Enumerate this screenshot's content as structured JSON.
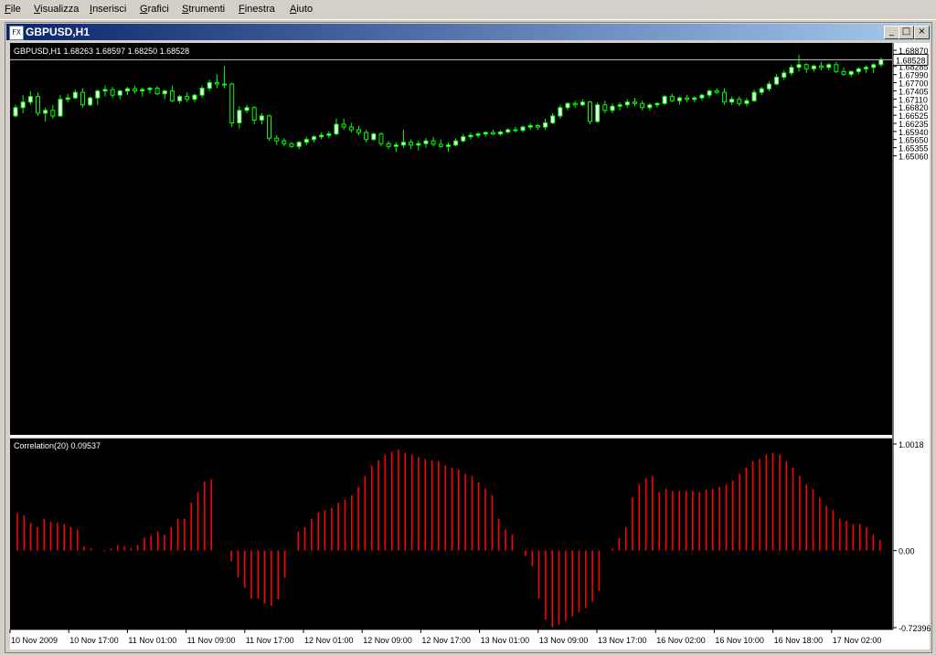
{
  "menu": [
    {
      "label": "File",
      "ul": "F",
      "rest": "ile"
    },
    {
      "label": "Visualizza",
      "ul": "V",
      "rest": "isualizza"
    },
    {
      "label": "Inserisci",
      "ul": "I",
      "rest": "nserisci"
    },
    {
      "label": "Grafici",
      "ul": "G",
      "rest": "rafici"
    },
    {
      "label": "Strumenti",
      "ul": "S",
      "rest": "trumenti"
    },
    {
      "label": "Finestra",
      "ul": "F",
      "rest": "inestra"
    },
    {
      "label": "Aiuto",
      "ul": "A",
      "rest": "iuto"
    }
  ],
  "window": {
    "title": "GBPUSD,H1",
    "icon_text": "FX",
    "minimize": "_",
    "restore": "□",
    "close": "×"
  },
  "price_panel": {
    "info": "GBPUSD,H1  1.68263 1.68597 1.68250 1.68528",
    "current_price": 1.68528,
    "current_price_label": "1.68528",
    "y_min": 1.5506,
    "y_max": 1.6887,
    "y_ticks": [
      "1.68870",
      "1.68285",
      "1.67990",
      "1.67700",
      "1.67405",
      "1.67110",
      "1.66820",
      "1.66525",
      "1.66235",
      "1.65940",
      "1.65650",
      "1.65355",
      "1.65060"
    ]
  },
  "indicator_panel": {
    "label": "Correlation(20) 0.09537",
    "y_min": -0.72396,
    "y_max": 1.0018,
    "y_ticks": [
      "1.0018",
      "0.00",
      "-0.72396"
    ]
  },
  "time_axis": [
    "10 Nov 2009",
    "10 Nov 17:00",
    "11 Nov 01:00",
    "11 Nov 09:00",
    "11 Nov 17:00",
    "12 Nov 01:00",
    "12 Nov 09:00",
    "12 Nov 17:00",
    "13 Nov 01:00",
    "13 Nov 09:00",
    "13 Nov 17:00",
    "16 Nov 02:00",
    "16 Nov 10:00",
    "16 Nov 18:00",
    "17 Nov 02:00"
  ],
  "colors": {
    "chart_bg": "#000000",
    "bull_body": "#ffffff",
    "bear_body": "#000000",
    "candle_line": "#00ff00",
    "histogram": "#ff0000",
    "bid_line": "#c0c0c0",
    "axis_text": "#000000",
    "panel_label": "#ffffff"
  },
  "chart_data": {
    "type": "candlestick",
    "candles": [
      [
        1.665,
        1.669,
        1.6645,
        1.668
      ],
      [
        1.668,
        1.6725,
        1.666,
        1.67
      ],
      [
        1.67,
        1.674,
        1.669,
        1.672
      ],
      [
        1.672,
        1.6735,
        1.665,
        1.666
      ],
      [
        1.666,
        1.668,
        1.663,
        1.667
      ],
      [
        1.667,
        1.669,
        1.664,
        1.665
      ],
      [
        1.665,
        1.6725,
        1.6645,
        1.671
      ],
      [
        1.671,
        1.673,
        1.67,
        1.6715
      ],
      [
        1.6715,
        1.6745,
        1.671,
        1.6735
      ],
      [
        1.6735,
        1.675,
        1.668,
        1.669
      ],
      [
        1.669,
        1.672,
        1.6685,
        1.6715
      ],
      [
        1.6715,
        1.6745,
        1.669,
        1.674
      ],
      [
        1.674,
        1.676,
        1.672,
        1.6745
      ],
      [
        1.6745,
        1.6755,
        1.6715,
        1.6725
      ],
      [
        1.6725,
        1.6745,
        1.671,
        1.674
      ],
      [
        1.674,
        1.6755,
        1.6725,
        1.6748
      ],
      [
        1.6748,
        1.676,
        1.673,
        1.674
      ],
      [
        1.674,
        1.6752,
        1.672,
        1.6745
      ],
      [
        1.6745,
        1.6755,
        1.673,
        1.675
      ],
      [
        1.675,
        1.6758,
        1.6725,
        1.673
      ],
      [
        1.673,
        1.6745,
        1.671,
        1.674
      ],
      [
        1.674,
        1.676,
        1.67,
        1.6705
      ],
      [
        1.6705,
        1.6725,
        1.6695,
        1.672
      ],
      [
        1.672,
        1.6735,
        1.67,
        1.671
      ],
      [
        1.671,
        1.673,
        1.67,
        1.6725
      ],
      [
        1.6725,
        1.676,
        1.6715,
        1.675
      ],
      [
        1.675,
        1.678,
        1.674,
        1.677
      ],
      [
        1.677,
        1.68,
        1.675,
        1.6765
      ],
      [
        1.6765,
        1.683,
        1.675,
        1.6765
      ],
      [
        1.6765,
        1.677,
        1.661,
        1.6625
      ],
      [
        1.6625,
        1.6685,
        1.6605,
        1.667
      ],
      [
        1.667,
        1.669,
        1.666,
        1.668
      ],
      [
        1.668,
        1.6685,
        1.662,
        1.6635
      ],
      [
        1.6635,
        1.666,
        1.662,
        1.665
      ],
      [
        1.665,
        1.6655,
        1.656,
        1.657
      ],
      [
        1.657,
        1.658,
        1.6545,
        1.656
      ],
      [
        1.656,
        1.657,
        1.654,
        1.655
      ],
      [
        1.655,
        1.6555,
        1.6535,
        1.654
      ],
      [
        1.654,
        1.656,
        1.653,
        1.6555
      ],
      [
        1.6555,
        1.6575,
        1.6545,
        1.6565
      ],
      [
        1.6565,
        1.658,
        1.6555,
        1.6575
      ],
      [
        1.6575,
        1.659,
        1.6565,
        1.658
      ],
      [
        1.658,
        1.6595,
        1.657,
        1.6585
      ],
      [
        1.6585,
        1.664,
        1.658,
        1.662
      ],
      [
        1.662,
        1.664,
        1.66,
        1.661
      ],
      [
        1.661,
        1.6625,
        1.659,
        1.66
      ],
      [
        1.66,
        1.6615,
        1.658,
        1.659
      ],
      [
        1.659,
        1.66,
        1.6555,
        1.6565
      ],
      [
        1.6565,
        1.659,
        1.656,
        1.6585
      ],
      [
        1.6585,
        1.659,
        1.654,
        1.655
      ],
      [
        1.655,
        1.656,
        1.653,
        1.654
      ],
      [
        1.654,
        1.6555,
        1.652,
        1.6545
      ],
      [
        1.6545,
        1.66,
        1.6535,
        1.6555
      ],
      [
        1.6555,
        1.6565,
        1.653,
        1.6545
      ],
      [
        1.6545,
        1.656,
        1.6525,
        1.655
      ],
      [
        1.655,
        1.657,
        1.6535,
        1.656
      ],
      [
        1.656,
        1.6575,
        1.654,
        1.6548
      ],
      [
        1.6548,
        1.6565,
        1.6535,
        1.654
      ],
      [
        1.654,
        1.6555,
        1.652,
        1.6545
      ],
      [
        1.6545,
        1.657,
        1.654,
        1.656
      ],
      [
        1.656,
        1.6585,
        1.6555,
        1.6575
      ],
      [
        1.6575,
        1.659,
        1.6565,
        1.658
      ],
      [
        1.658,
        1.6592,
        1.657,
        1.6585
      ],
      [
        1.6585,
        1.6595,
        1.6575,
        1.659
      ],
      [
        1.659,
        1.66,
        1.658,
        1.6585
      ],
      [
        1.6585,
        1.6598,
        1.6578,
        1.6592
      ],
      [
        1.6592,
        1.6605,
        1.6585,
        1.66
      ],
      [
        1.66,
        1.661,
        1.659,
        1.6598
      ],
      [
        1.6598,
        1.6615,
        1.659,
        1.661
      ],
      [
        1.661,
        1.6625,
        1.66,
        1.6615
      ],
      [
        1.6615,
        1.662,
        1.66,
        1.661
      ],
      [
        1.661,
        1.664,
        1.66,
        1.6625
      ],
      [
        1.6625,
        1.666,
        1.662,
        1.665
      ],
      [
        1.665,
        1.669,
        1.664,
        1.668
      ],
      [
        1.668,
        1.67,
        1.667,
        1.6695
      ],
      [
        1.6695,
        1.6705,
        1.668,
        1.669
      ],
      [
        1.669,
        1.671,
        1.6685,
        1.67
      ],
      [
        1.67,
        1.6705,
        1.662,
        1.663
      ],
      [
        1.663,
        1.67,
        1.6625,
        1.669
      ],
      [
        1.669,
        1.6705,
        1.666,
        1.667
      ],
      [
        1.667,
        1.6695,
        1.666,
        1.6685
      ],
      [
        1.6685,
        1.67,
        1.667,
        1.669
      ],
      [
        1.669,
        1.671,
        1.668,
        1.67
      ],
      [
        1.67,
        1.6715,
        1.6685,
        1.6695
      ],
      [
        1.6695,
        1.6705,
        1.667,
        1.668
      ],
      [
        1.668,
        1.6695,
        1.667,
        1.669
      ],
      [
        1.669,
        1.67,
        1.668,
        1.6695
      ],
      [
        1.6695,
        1.6725,
        1.669,
        1.672
      ],
      [
        1.672,
        1.673,
        1.67,
        1.6705
      ],
      [
        1.6705,
        1.672,
        1.669,
        1.6715
      ],
      [
        1.6715,
        1.6725,
        1.67,
        1.671
      ],
      [
        1.671,
        1.672,
        1.67,
        1.6715
      ],
      [
        1.6715,
        1.673,
        1.6705,
        1.6725
      ],
      [
        1.6725,
        1.6745,
        1.6715,
        1.674
      ],
      [
        1.674,
        1.675,
        1.673,
        1.6735
      ],
      [
        1.6735,
        1.675,
        1.669,
        1.67
      ],
      [
        1.67,
        1.672,
        1.669,
        1.671
      ],
      [
        1.671,
        1.672,
        1.6685,
        1.6695
      ],
      [
        1.6695,
        1.6715,
        1.6685,
        1.6705
      ],
      [
        1.6705,
        1.6745,
        1.67,
        1.6735
      ],
      [
        1.6735,
        1.6755,
        1.6725,
        1.6748
      ],
      [
        1.6748,
        1.6775,
        1.674,
        1.6765
      ],
      [
        1.6765,
        1.68,
        1.676,
        1.679
      ],
      [
        1.679,
        1.6815,
        1.678,
        1.6805
      ],
      [
        1.6805,
        1.6835,
        1.6795,
        1.6825
      ],
      [
        1.6825,
        1.687,
        1.681,
        1.6835
      ],
      [
        1.6835,
        1.684,
        1.6805,
        1.682
      ],
      [
        1.682,
        1.6835,
        1.681,
        1.683
      ],
      [
        1.683,
        1.6845,
        1.6815,
        1.6825
      ],
      [
        1.6825,
        1.684,
        1.6815,
        1.6835
      ],
      [
        1.6835,
        1.6845,
        1.6805,
        1.681
      ],
      [
        1.681,
        1.6825,
        1.6795,
        1.68
      ],
      [
        1.68,
        1.6815,
        1.679,
        1.681
      ],
      [
        1.681,
        1.6825,
        1.68,
        1.682
      ],
      [
        1.682,
        1.6832,
        1.6805,
        1.6825
      ],
      [
        1.6825,
        1.684,
        1.6805,
        1.6835
      ],
      [
        1.6835,
        1.686,
        1.6826,
        1.6853
      ]
    ],
    "correlation": [
      0.35,
      0.33,
      0.26,
      0.22,
      0.3,
      0.27,
      0.26,
      0.25,
      0.22,
      0.2,
      0.04,
      0.02,
      0.0,
      -0.01,
      0.02,
      0.05,
      0.04,
      0.02,
      0.05,
      0.12,
      0.14,
      0.18,
      0.15,
      0.22,
      0.3,
      0.3,
      0.45,
      0.55,
      0.65,
      0.67,
      0.0,
      0.0,
      -0.1,
      -0.25,
      -0.35,
      -0.45,
      -0.45,
      -0.5,
      -0.52,
      -0.46,
      -0.25,
      0.0,
      0.18,
      0.22,
      0.3,
      0.36,
      0.38,
      0.4,
      0.45,
      0.48,
      0.52,
      0.6,
      0.7,
      0.8,
      0.85,
      0.9,
      0.93,
      0.95,
      0.92,
      0.9,
      0.88,
      0.86,
      0.85,
      0.84,
      0.8,
      0.78,
      0.76,
      0.72,
      0.7,
      0.64,
      0.58,
      0.52,
      0.3,
      0.2,
      0.15,
      0.0,
      -0.05,
      -0.15,
      -0.45,
      -0.65,
      -0.72,
      -0.7,
      -0.66,
      -0.62,
      -0.58,
      -0.54,
      -0.48,
      -0.38,
      0.0,
      0.02,
      0.12,
      0.22,
      0.5,
      0.62,
      0.68,
      0.7,
      0.55,
      0.58,
      0.56,
      0.56,
      0.56,
      0.56,
      0.55,
      0.57,
      0.58,
      0.6,
      0.62,
      0.66,
      0.72,
      0.78,
      0.84,
      0.86,
      0.9,
      0.92,
      0.9,
      0.84,
      0.78,
      0.7,
      0.62,
      0.58,
      0.5,
      0.42,
      0.38,
      0.3,
      0.28,
      0.25,
      0.25,
      0.22,
      0.15,
      0.1
    ]
  }
}
